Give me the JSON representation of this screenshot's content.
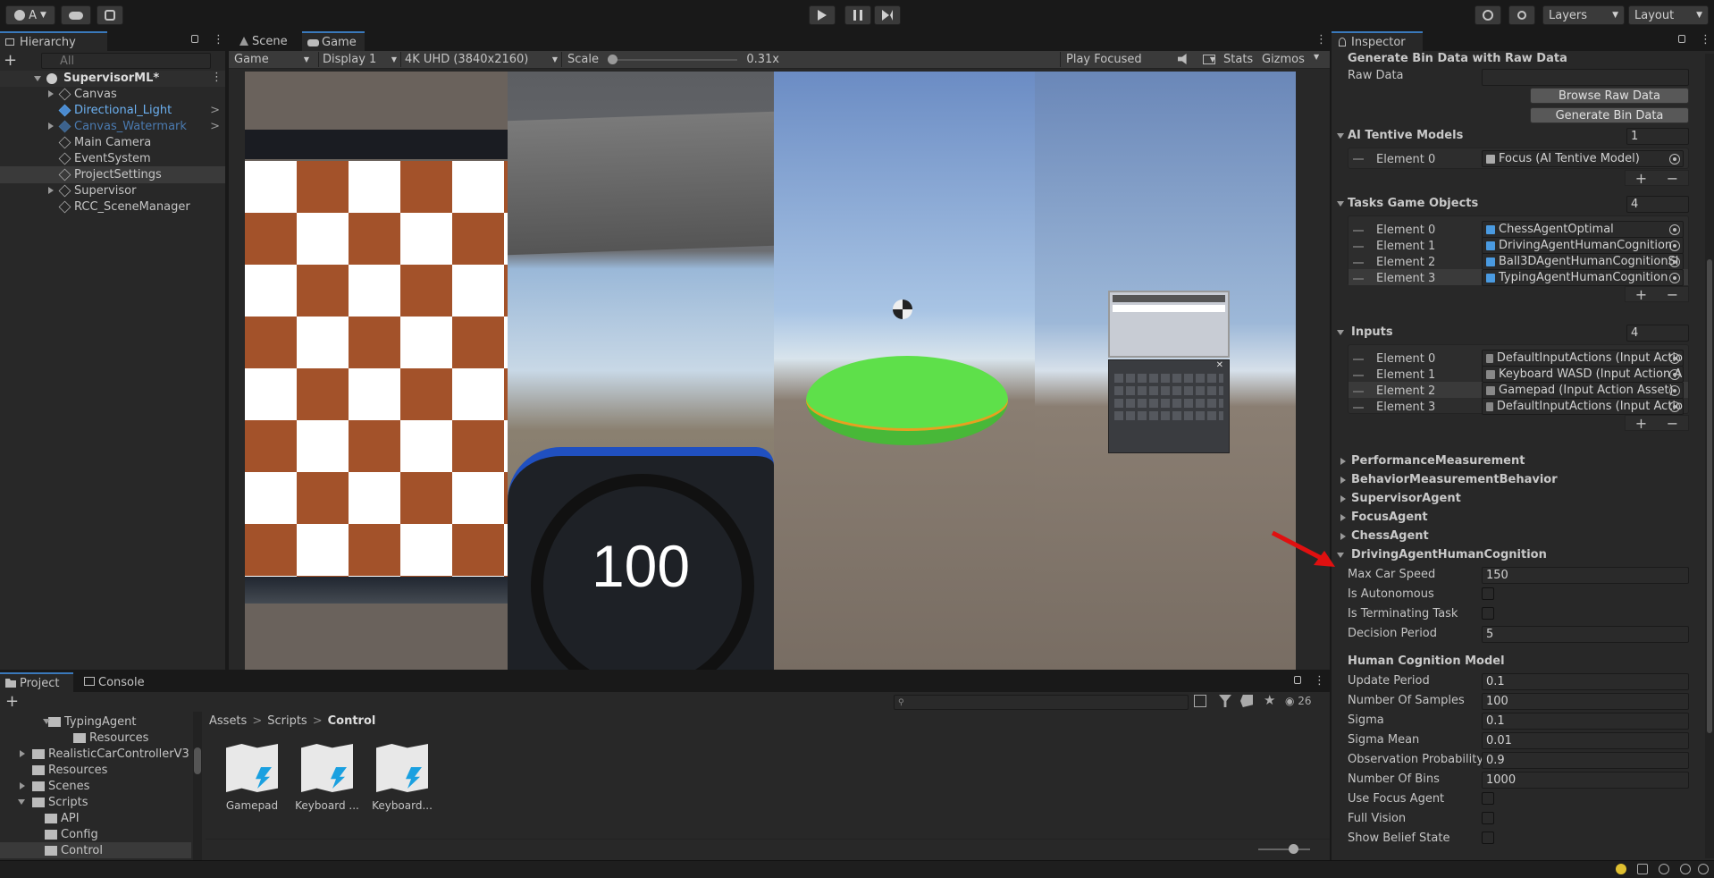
{
  "toolbar": {
    "account": "A",
    "layers": "Layers",
    "layout": "Layout"
  },
  "hierarchy": {
    "tab": "Hierarchy",
    "search_placeholder": "All",
    "scene": "SupervisorML*",
    "items": [
      {
        "label": "Canvas"
      },
      {
        "label": "Directional_Light"
      },
      {
        "label": "Canvas_Watermark"
      },
      {
        "label": "Main Camera"
      },
      {
        "label": "EventSystem"
      },
      {
        "label": "ProjectSettings"
      },
      {
        "label": "Supervisor"
      },
      {
        "label": "RCC_SceneManager"
      }
    ]
  },
  "game": {
    "tab_scene": "Scene",
    "tab_game": "Game",
    "view": "Game",
    "display": "Display 1",
    "resolution": "4K UHD (3840x2160)",
    "scale_label": "Scale",
    "scale_value": "0.31x",
    "play_mode": "Play Focused",
    "stats": "Stats",
    "gizmos": "Gizmos",
    "speed": "100"
  },
  "project": {
    "tab_project": "Project",
    "tab_console": "Console",
    "count": "26",
    "tree": [
      {
        "label": "TypingAgent"
      },
      {
        "label": "Resources"
      },
      {
        "label": "RealisticCarControllerV3"
      },
      {
        "label": "Resources"
      },
      {
        "label": "Scenes"
      },
      {
        "label": "Scripts"
      },
      {
        "label": "API"
      },
      {
        "label": "Config"
      },
      {
        "label": "Control"
      }
    ],
    "breadcrumb": [
      "Assets",
      "Scripts",
      "Control"
    ],
    "assets": [
      {
        "label": "Gamepad"
      },
      {
        "label": "Keyboard ..."
      },
      {
        "label": "Keyboard..."
      }
    ]
  },
  "inspector": {
    "tab": "Inspector",
    "gen_header": "Generate Bin Data with Raw Data",
    "raw_data": "Raw Data",
    "browse": "Browse Raw Data",
    "generate": "Generate Bin Data",
    "models": {
      "label": "AI Tentive Models",
      "count": "1",
      "elements": [
        {
          "name": "Element 0",
          "value": "Focus (AI Tentive Model)"
        }
      ]
    },
    "tasks": {
      "label": "Tasks Game Objects",
      "count": "4",
      "elements": [
        {
          "name": "Element 0",
          "value": "ChessAgentOptimal"
        },
        {
          "name": "Element 1",
          "value": "DrivingAgentHumanCognition"
        },
        {
          "name": "Element 2",
          "value": "Ball3DAgentHumanCognitionSi"
        },
        {
          "name": "Element 3",
          "value": "TypingAgentHumanCognition"
        }
      ]
    },
    "inputs": {
      "label": "Inputs",
      "count": "4",
      "elements": [
        {
          "name": "Element 0",
          "value": "DefaultInputActions (Input Actio"
        },
        {
          "name": "Element 1",
          "value": "Keyboard WASD (Input Action A"
        },
        {
          "name": "Element 2",
          "value": "Gamepad (Input Action Asset)"
        },
        {
          "name": "Element 3",
          "value": "DefaultInputActions (Input Actio"
        }
      ]
    },
    "components": [
      "PerformanceMeasurement",
      "BehaviorMeasurementBehavior",
      "SupervisorAgent",
      "FocusAgent",
      "ChessAgent",
      "DrivingAgentHumanCognition"
    ],
    "driving": {
      "max_car_speed_label": "Max Car Speed",
      "max_car_speed": "150",
      "is_autonomous": "Is Autonomous",
      "is_terminating": "Is Terminating Task",
      "decision_period_label": "Decision Period",
      "decision_period": "5"
    },
    "hcm": {
      "header": "Human Cognition Model",
      "update_period_label": "Update Period",
      "update_period": "0.1",
      "samples_label": "Number Of Samples",
      "samples": "100",
      "sigma_label": "Sigma",
      "sigma": "0.1",
      "sigma_mean_label": "Sigma Mean",
      "sigma_mean": "0.01",
      "obs_prob_label": "Observation Probability",
      "obs_prob": "0.9",
      "bins_label": "Number Of Bins",
      "bins": "1000",
      "use_focus": "Use Focus Agent",
      "full_vision": "Full Vision",
      "show_belief": "Show Belief State"
    }
  },
  "colors": {
    "accent": "#3a79bb",
    "prefab_blue": "#5aa2e8",
    "arrow": "#e01010"
  },
  "icons": [
    "account-icon",
    "cloud-icon",
    "settings-icon",
    "play-icon",
    "pause-icon",
    "step-icon",
    "history-icon",
    "search-icon",
    "lock-icon",
    "menu-icon"
  ]
}
